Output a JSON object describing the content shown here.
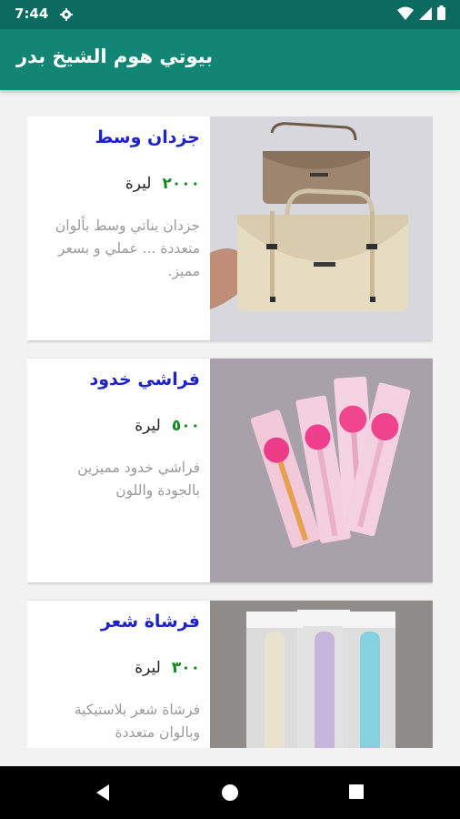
{
  "status": {
    "time": "7:44",
    "icons": [
      "gear-icon",
      "wifi-icon",
      "signal-icon",
      "battery-icon"
    ]
  },
  "app": {
    "title": "بيوتي هوم الشيخ بدر",
    "colors": {
      "status_bar": "#0c6b60",
      "app_bar": "#138575",
      "title_link": "#1d22c9",
      "price": "#118a1c"
    }
  },
  "products": [
    {
      "title": "جزدان وسط",
      "price": "٢٠٠٠",
      "currency": "ليرة",
      "description": "جزدان بناتي وسط بألوان متعددة ... عملي و بسعر مميز.",
      "image": "handbag-photo"
    },
    {
      "title": "فراشي خدود",
      "price": "٥٠٠",
      "currency": "ليرة",
      "description": "فراشي خدود مميزين بالجودة واللون",
      "image": "blush-brushes-photo"
    },
    {
      "title": "فرشاة شعر",
      "price": "٣٠٠",
      "currency": "ليرة",
      "description": "فرشاة شعر بلاستيكية وبالوان متعددة",
      "image": "hair-brush-photo"
    }
  ],
  "nav": {
    "buttons": [
      "back-icon",
      "home-icon",
      "recents-icon"
    ]
  }
}
